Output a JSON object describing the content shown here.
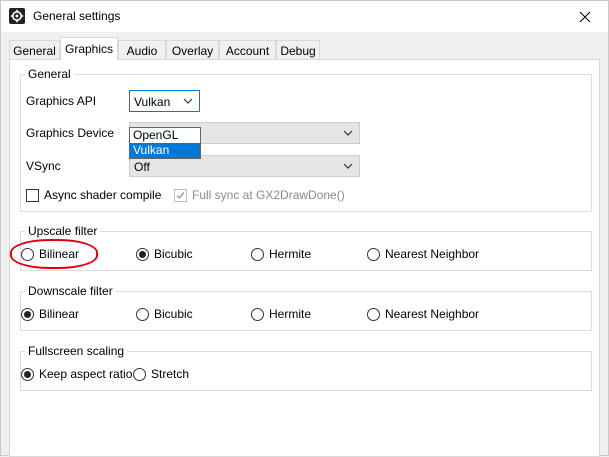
{
  "window": {
    "title": "General settings"
  },
  "tabs": [
    "General",
    "Graphics",
    "Audio",
    "Overlay",
    "Account",
    "Debug"
  ],
  "general": {
    "group_title": "General",
    "api_label": "Graphics API",
    "api_value": "Vulkan",
    "api_options": [
      "OpenGL",
      "Vulkan"
    ],
    "device_label": "Graphics Device",
    "device_value": "",
    "vsync_label": "VSync",
    "vsync_value": "Off",
    "async_label": "Async shader compile",
    "async_checked": false,
    "fullsync_label": "Full sync at GX2DrawDone()",
    "fullsync_checked": true
  },
  "upscale": {
    "title": "Upscale filter",
    "options": [
      "Bilinear",
      "Bicubic",
      "Hermite",
      "Nearest Neighbor"
    ],
    "selected": "Bicubic"
  },
  "downscale": {
    "title": "Downscale filter",
    "options": [
      "Bilinear",
      "Bicubic",
      "Hermite",
      "Nearest Neighbor"
    ],
    "selected": "Bilinear"
  },
  "fullscreen": {
    "title": "Fullscreen scaling",
    "options": [
      "Keep aspect ratio",
      "Stretch"
    ],
    "selected": "Keep aspect ratio"
  },
  "colors": {
    "accent": "#0078d7",
    "annotation": "#e00010"
  },
  "icons": {
    "app": "gear-icon",
    "close": "close-icon",
    "dropdown": "chevron-down-icon"
  }
}
